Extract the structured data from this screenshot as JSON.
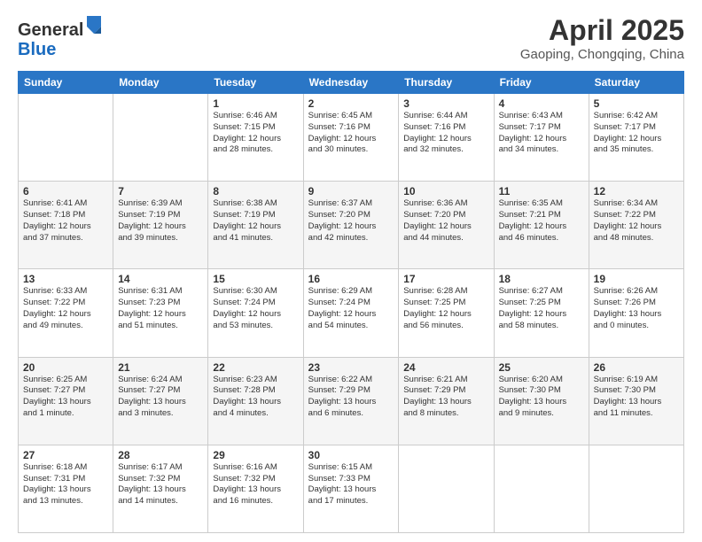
{
  "logo": {
    "general": "General",
    "blue": "Blue"
  },
  "title": "April 2025",
  "subtitle": "Gaoping, Chongqing, China",
  "headers": [
    "Sunday",
    "Monday",
    "Tuesday",
    "Wednesday",
    "Thursday",
    "Friday",
    "Saturday"
  ],
  "weeks": [
    [
      {
        "day": "",
        "info": ""
      },
      {
        "day": "",
        "info": ""
      },
      {
        "day": "1",
        "info": "Sunrise: 6:46 AM\nSunset: 7:15 PM\nDaylight: 12 hours\nand 28 minutes."
      },
      {
        "day": "2",
        "info": "Sunrise: 6:45 AM\nSunset: 7:16 PM\nDaylight: 12 hours\nand 30 minutes."
      },
      {
        "day": "3",
        "info": "Sunrise: 6:44 AM\nSunset: 7:16 PM\nDaylight: 12 hours\nand 32 minutes."
      },
      {
        "day": "4",
        "info": "Sunrise: 6:43 AM\nSunset: 7:17 PM\nDaylight: 12 hours\nand 34 minutes."
      },
      {
        "day": "5",
        "info": "Sunrise: 6:42 AM\nSunset: 7:17 PM\nDaylight: 12 hours\nand 35 minutes."
      }
    ],
    [
      {
        "day": "6",
        "info": "Sunrise: 6:41 AM\nSunset: 7:18 PM\nDaylight: 12 hours\nand 37 minutes."
      },
      {
        "day": "7",
        "info": "Sunrise: 6:39 AM\nSunset: 7:19 PM\nDaylight: 12 hours\nand 39 minutes."
      },
      {
        "day": "8",
        "info": "Sunrise: 6:38 AM\nSunset: 7:19 PM\nDaylight: 12 hours\nand 41 minutes."
      },
      {
        "day": "9",
        "info": "Sunrise: 6:37 AM\nSunset: 7:20 PM\nDaylight: 12 hours\nand 42 minutes."
      },
      {
        "day": "10",
        "info": "Sunrise: 6:36 AM\nSunset: 7:20 PM\nDaylight: 12 hours\nand 44 minutes."
      },
      {
        "day": "11",
        "info": "Sunrise: 6:35 AM\nSunset: 7:21 PM\nDaylight: 12 hours\nand 46 minutes."
      },
      {
        "day": "12",
        "info": "Sunrise: 6:34 AM\nSunset: 7:22 PM\nDaylight: 12 hours\nand 48 minutes."
      }
    ],
    [
      {
        "day": "13",
        "info": "Sunrise: 6:33 AM\nSunset: 7:22 PM\nDaylight: 12 hours\nand 49 minutes."
      },
      {
        "day": "14",
        "info": "Sunrise: 6:31 AM\nSunset: 7:23 PM\nDaylight: 12 hours\nand 51 minutes."
      },
      {
        "day": "15",
        "info": "Sunrise: 6:30 AM\nSunset: 7:24 PM\nDaylight: 12 hours\nand 53 minutes."
      },
      {
        "day": "16",
        "info": "Sunrise: 6:29 AM\nSunset: 7:24 PM\nDaylight: 12 hours\nand 54 minutes."
      },
      {
        "day": "17",
        "info": "Sunrise: 6:28 AM\nSunset: 7:25 PM\nDaylight: 12 hours\nand 56 minutes."
      },
      {
        "day": "18",
        "info": "Sunrise: 6:27 AM\nSunset: 7:25 PM\nDaylight: 12 hours\nand 58 minutes."
      },
      {
        "day": "19",
        "info": "Sunrise: 6:26 AM\nSunset: 7:26 PM\nDaylight: 13 hours\nand 0 minutes."
      }
    ],
    [
      {
        "day": "20",
        "info": "Sunrise: 6:25 AM\nSunset: 7:27 PM\nDaylight: 13 hours\nand 1 minute."
      },
      {
        "day": "21",
        "info": "Sunrise: 6:24 AM\nSunset: 7:27 PM\nDaylight: 13 hours\nand 3 minutes."
      },
      {
        "day": "22",
        "info": "Sunrise: 6:23 AM\nSunset: 7:28 PM\nDaylight: 13 hours\nand 4 minutes."
      },
      {
        "day": "23",
        "info": "Sunrise: 6:22 AM\nSunset: 7:29 PM\nDaylight: 13 hours\nand 6 minutes."
      },
      {
        "day": "24",
        "info": "Sunrise: 6:21 AM\nSunset: 7:29 PM\nDaylight: 13 hours\nand 8 minutes."
      },
      {
        "day": "25",
        "info": "Sunrise: 6:20 AM\nSunset: 7:30 PM\nDaylight: 13 hours\nand 9 minutes."
      },
      {
        "day": "26",
        "info": "Sunrise: 6:19 AM\nSunset: 7:30 PM\nDaylight: 13 hours\nand 11 minutes."
      }
    ],
    [
      {
        "day": "27",
        "info": "Sunrise: 6:18 AM\nSunset: 7:31 PM\nDaylight: 13 hours\nand 13 minutes."
      },
      {
        "day": "28",
        "info": "Sunrise: 6:17 AM\nSunset: 7:32 PM\nDaylight: 13 hours\nand 14 minutes."
      },
      {
        "day": "29",
        "info": "Sunrise: 6:16 AM\nSunset: 7:32 PM\nDaylight: 13 hours\nand 16 minutes."
      },
      {
        "day": "30",
        "info": "Sunrise: 6:15 AM\nSunset: 7:33 PM\nDaylight: 13 hours\nand 17 minutes."
      },
      {
        "day": "",
        "info": ""
      },
      {
        "day": "",
        "info": ""
      },
      {
        "day": "",
        "info": ""
      }
    ]
  ]
}
